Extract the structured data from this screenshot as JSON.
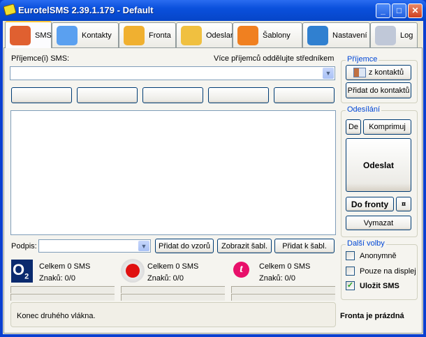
{
  "window": {
    "title": "EurotelSMS 2.39.1.179 - Default",
    "minimize": "_",
    "maximize": "□",
    "close": "✕"
  },
  "tabs": [
    {
      "label": "SMS",
      "icon": "pencil-paper-icon",
      "color": "#e06030"
    },
    {
      "label": "Kontakty",
      "icon": "people-icon",
      "color": "#5aa0f0"
    },
    {
      "label": "Fronta",
      "icon": "folder-clock-icon",
      "color": "#f0b030"
    },
    {
      "label": "Odeslané",
      "icon": "folder-paper-icon",
      "color": "#f0c040"
    },
    {
      "label": "Šablony",
      "icon": "folder-arrow-icon",
      "color": "#f08020"
    },
    {
      "label": "Nastavení",
      "icon": "settings-check-icon",
      "color": "#3080d0"
    },
    {
      "label": "Log",
      "icon": "document-icon",
      "color": "#c0c8d8"
    }
  ],
  "recipients": {
    "label": "Příjemce(i) SMS:",
    "hint": "Více příjemců oddělujte středníkem",
    "value": ""
  },
  "signature": {
    "label": "Podpis:",
    "value": "",
    "add_pattern": "Přidat do vzorů",
    "show_templates": "Zobrazit šabl.",
    "add_template": "Přidat k šabl."
  },
  "operators": [
    {
      "name": "o2-logo",
      "total": "Celkem 0 SMS",
      "chars": "Znaků: 0/0"
    },
    {
      "name": "vodafone-logo",
      "total": "Celkem 0 SMS",
      "chars": "Znaků: 0/0"
    },
    {
      "name": "t-mobile-logo",
      "total": "Celkem 0 SMS",
      "chars": "Znaků: 0/0"
    }
  ],
  "status": "Konec druhého vlákna.",
  "right": {
    "recipient_group": "Příjemce",
    "from_contacts": "z kontaktů",
    "add_contacts": "Přidat do kontaktů",
    "send_group": "Odesílání",
    "de": "De",
    "compress": "Komprimuj",
    "send": "Odeslat",
    "queue": "Do fronty",
    "queue_extra": "¤",
    "clear": "Vymazat",
    "options_group": "Další volby",
    "options": [
      {
        "label": "Anonymně",
        "checked": false
      },
      {
        "label": "Pouze na displej",
        "checked": false
      },
      {
        "label": "Uložit SMS",
        "checked": true
      }
    ],
    "queue_status": "Fronta je prázdná"
  }
}
